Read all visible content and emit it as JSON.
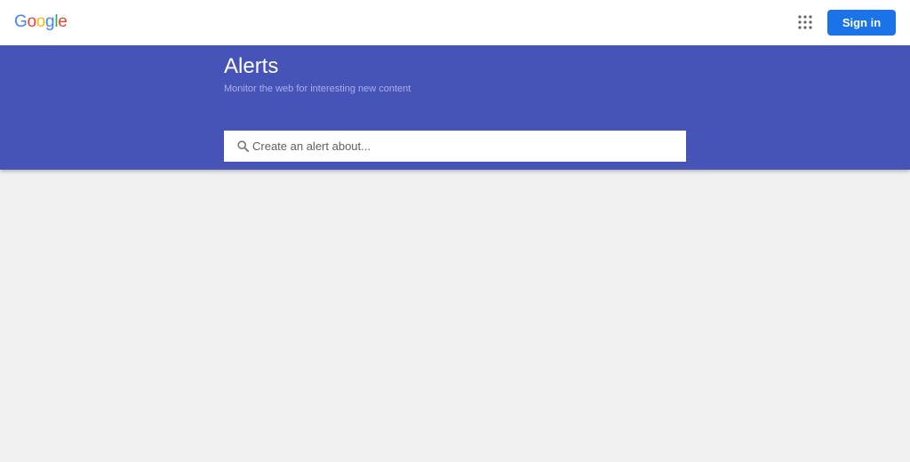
{
  "header": {
    "logo_letters": [
      {
        "char": "G",
        "color": "#4285f4"
      },
      {
        "char": "o",
        "color": "#ea4335"
      },
      {
        "char": "o",
        "color": "#fbbc05"
      },
      {
        "char": "g",
        "color": "#4285f4"
      },
      {
        "char": "l",
        "color": "#34a853"
      },
      {
        "char": "e",
        "color": "#ea4335"
      }
    ],
    "apps_icon": "apps-grid-icon",
    "signin_label": "Sign in",
    "signin_color": "#1a73e8"
  },
  "hero": {
    "title": "Alerts",
    "subtitle": "Monitor the web for interesting new content",
    "background_color": "#4653b7"
  },
  "search": {
    "placeholder": "Create an alert about...",
    "value": "",
    "icon": "search-icon"
  }
}
